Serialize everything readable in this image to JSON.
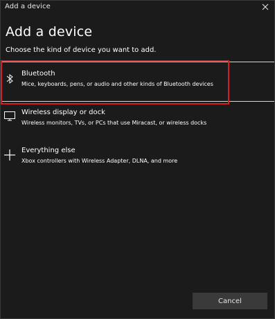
{
  "window": {
    "title": "Add a device"
  },
  "main": {
    "heading": "Add a device",
    "subheading": "Choose the kind of device you want to add."
  },
  "options": [
    {
      "icon": "bluetooth-icon",
      "title": "Bluetooth",
      "description": "Mice, keyboards, pens, or audio and other kinds of Bluetooth devices",
      "highlighted": true
    },
    {
      "icon": "monitor-icon",
      "title": "Wireless display or dock",
      "description": "Wireless monitors, TVs, or PCs that use Miracast, or wireless docks",
      "highlighted": false
    },
    {
      "icon": "plus-icon",
      "title": "Everything else",
      "description": "Xbox controllers with Wireless Adapter, DLNA, and more",
      "highlighted": false
    }
  ],
  "footer": {
    "cancel_label": "Cancel"
  },
  "colors": {
    "background": "#1b1b1b",
    "highlight_border": "#d51e24",
    "button_bg": "#3a3a3a",
    "text": "#ffffff"
  }
}
